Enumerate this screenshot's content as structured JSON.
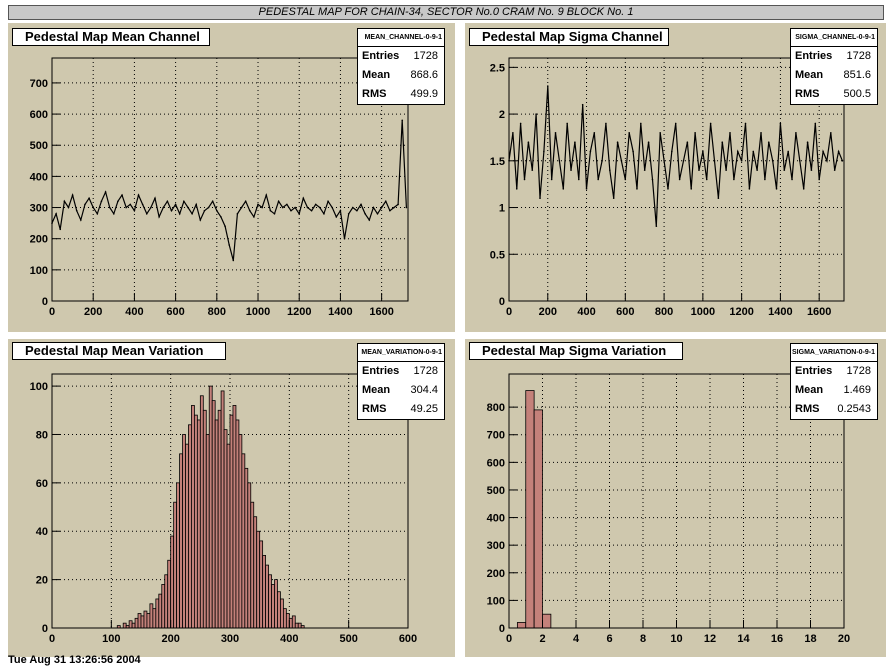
{
  "banner": "PEDESTAL MAP FOR CHAIN-34, SECTOR No.0 CRAM No. 9 BLOCK No. 1",
  "footer": "Tue Aug 31 13:26:56 2004",
  "colors": {
    "pad": "#cfc8ae",
    "fill": "#c4817a",
    "line": "#000000"
  },
  "chart_data": [
    {
      "id": "mean_channel",
      "type": "line",
      "title": "Pedestal Map Mean Channel",
      "stats": {
        "name": "MEAN_CHANNEL-0-9-1",
        "entries": "1728",
        "mean": "868.6",
        "rms": "499.9"
      },
      "xlim": [
        0,
        1728
      ],
      "ylim": [
        0,
        780
      ],
      "xticks": [
        0,
        200,
        400,
        600,
        800,
        1000,
        1200,
        1400,
        1600
      ],
      "yticks": [
        0,
        100,
        200,
        300,
        400,
        500,
        600,
        700
      ],
      "x": [
        0,
        20,
        40,
        60,
        80,
        100,
        120,
        140,
        160,
        180,
        200,
        220,
        240,
        260,
        280,
        300,
        320,
        340,
        360,
        380,
        400,
        420,
        440,
        460,
        480,
        500,
        520,
        540,
        560,
        580,
        600,
        620,
        640,
        660,
        680,
        700,
        720,
        740,
        760,
        780,
        800,
        820,
        840,
        860,
        880,
        900,
        920,
        940,
        960,
        980,
        1000,
        1020,
        1040,
        1060,
        1080,
        1100,
        1120,
        1140,
        1160,
        1180,
        1200,
        1220,
        1240,
        1260,
        1280,
        1300,
        1320,
        1340,
        1360,
        1380,
        1400,
        1420,
        1440,
        1460,
        1480,
        1500,
        1520,
        1540,
        1560,
        1580,
        1600,
        1620,
        1640,
        1660,
        1680,
        1700,
        1720
      ],
      "y": [
        250,
        280,
        230,
        320,
        300,
        340,
        290,
        260,
        310,
        330,
        300,
        280,
        320,
        350,
        300,
        280,
        320,
        340,
        300,
        310,
        290,
        340,
        310,
        280,
        300,
        330,
        270,
        300,
        320,
        290,
        310,
        280,
        320,
        300,
        280,
        310,
        260,
        290,
        300,
        320,
        290,
        270,
        240,
        180,
        130,
        280,
        300,
        320,
        290,
        270,
        310,
        300,
        340,
        290,
        280,
        320,
        300,
        310,
        290,
        300,
        280,
        330,
        300,
        290,
        310,
        300,
        280,
        320,
        300,
        270,
        290,
        200,
        280,
        300,
        290,
        310,
        280,
        260,
        300,
        280,
        300,
        320,
        290,
        300,
        310,
        580,
        300,
        320
      ]
    },
    {
      "id": "sigma_channel",
      "type": "line",
      "title": "Pedestal Map Sigma Channel",
      "stats": {
        "name": "SIGMA_CHANNEL-0-9-1",
        "entries": "1728",
        "mean": "851.6",
        "rms": "500.5"
      },
      "xlim": [
        0,
        1728
      ],
      "ylim": [
        0,
        2.6
      ],
      "xticks": [
        0,
        200,
        400,
        600,
        800,
        1000,
        1200,
        1400,
        1600
      ],
      "yticks": [
        0,
        0.5,
        1,
        1.5,
        2,
        2.5
      ],
      "x": [
        0,
        20,
        40,
        60,
        80,
        100,
        120,
        140,
        160,
        180,
        200,
        220,
        240,
        260,
        280,
        300,
        320,
        340,
        360,
        380,
        400,
        420,
        440,
        460,
        480,
        500,
        520,
        540,
        560,
        580,
        600,
        620,
        640,
        660,
        680,
        700,
        720,
        740,
        760,
        780,
        800,
        820,
        840,
        860,
        880,
        900,
        920,
        940,
        960,
        980,
        1000,
        1020,
        1040,
        1060,
        1080,
        1100,
        1120,
        1140,
        1160,
        1180,
        1200,
        1220,
        1240,
        1260,
        1280,
        1300,
        1320,
        1340,
        1360,
        1380,
        1400,
        1420,
        1440,
        1460,
        1480,
        1500,
        1520,
        1540,
        1560,
        1580,
        1600,
        1620,
        1640,
        1660,
        1680,
        1700,
        1720
      ],
      "y": [
        1.5,
        1.8,
        1.2,
        1.9,
        1.3,
        1.7,
        1.4,
        2.0,
        1.1,
        1.6,
        2.3,
        1.3,
        1.8,
        1.5,
        1.2,
        1.9,
        1.4,
        1.7,
        1.3,
        2.1,
        1.2,
        1.6,
        1.8,
        1.3,
        1.5,
        1.9,
        1.4,
        1.1,
        1.7,
        1.5,
        1.3,
        1.8,
        1.6,
        1.2,
        1.9,
        1.4,
        1.7,
        1.3,
        0.8,
        1.8,
        1.5,
        1.2,
        1.6,
        1.9,
        1.3,
        1.5,
        1.7,
        1.2,
        1.8,
        1.4,
        1.6,
        1.3,
        1.9,
        1.5,
        1.1,
        1.7,
        1.4,
        1.8,
        1.3,
        1.6,
        1.5,
        1.9,
        1.2,
        1.6,
        1.4,
        1.8,
        1.3,
        1.7,
        1.5,
        1.2,
        1.9,
        1.4,
        1.6,
        1.3,
        1.8,
        1.5,
        1.2,
        1.7,
        1.4,
        1.9,
        1.3,
        1.6,
        1.5,
        1.8,
        1.4,
        1.6,
        1.5,
        1.7
      ]
    },
    {
      "id": "mean_variation",
      "type": "bar",
      "title": "Pedestal Map Mean Variation",
      "stats": {
        "name": "MEAN_VARIATION-0-9-1",
        "entries": "1728",
        "mean": "304.4",
        "rms": "49.25"
      },
      "xlim": [
        0,
        600
      ],
      "ylim": [
        0,
        105
      ],
      "xticks": [
        0,
        100,
        200,
        300,
        400,
        500,
        600
      ],
      "yticks": [
        0,
        20,
        40,
        60,
        80,
        100
      ],
      "bin_width": 5,
      "x": [
        110,
        115,
        120,
        125,
        130,
        135,
        140,
        145,
        150,
        155,
        160,
        165,
        170,
        175,
        180,
        185,
        190,
        195,
        200,
        205,
        210,
        215,
        220,
        225,
        230,
        235,
        240,
        245,
        250,
        255,
        260,
        265,
        270,
        275,
        280,
        285,
        290,
        295,
        300,
        305,
        310,
        315,
        320,
        325,
        330,
        335,
        340,
        345,
        350,
        355,
        360,
        365,
        370,
        375,
        380,
        385,
        390,
        395,
        400,
        405,
        410,
        415,
        420
      ],
      "values": [
        1,
        0,
        2,
        1,
        3,
        2,
        4,
        6,
        5,
        7,
        6,
        10,
        8,
        12,
        14,
        18,
        22,
        28,
        38,
        52,
        60,
        72,
        80,
        76,
        84,
        92,
        88,
        86,
        96,
        90,
        80,
        100,
        94,
        86,
        90,
        98,
        82,
        76,
        88,
        92,
        86,
        80,
        72,
        66,
        60,
        52,
        46,
        40,
        36,
        30,
        26,
        22,
        18,
        20,
        15,
        12,
        8,
        6,
        4,
        5,
        2,
        2,
        1
      ]
    },
    {
      "id": "sigma_variation",
      "type": "bar",
      "title": "Pedestal Map Sigma Variation",
      "stats": {
        "name": "SIGMA_VARIATION-0-9-1",
        "entries": "1728",
        "mean": "1.469",
        "rms": "0.2543"
      },
      "xlim": [
        0,
        20
      ],
      "ylim": [
        0,
        920
      ],
      "xticks": [
        0,
        2,
        4,
        6,
        8,
        10,
        12,
        14,
        16,
        18,
        20
      ],
      "yticks": [
        0,
        100,
        200,
        300,
        400,
        500,
        600,
        700,
        800
      ],
      "bin_width": 0.5,
      "x": [
        0.5,
        1.0,
        1.5,
        2.0
      ],
      "values": [
        20,
        860,
        790,
        50
      ]
    }
  ]
}
